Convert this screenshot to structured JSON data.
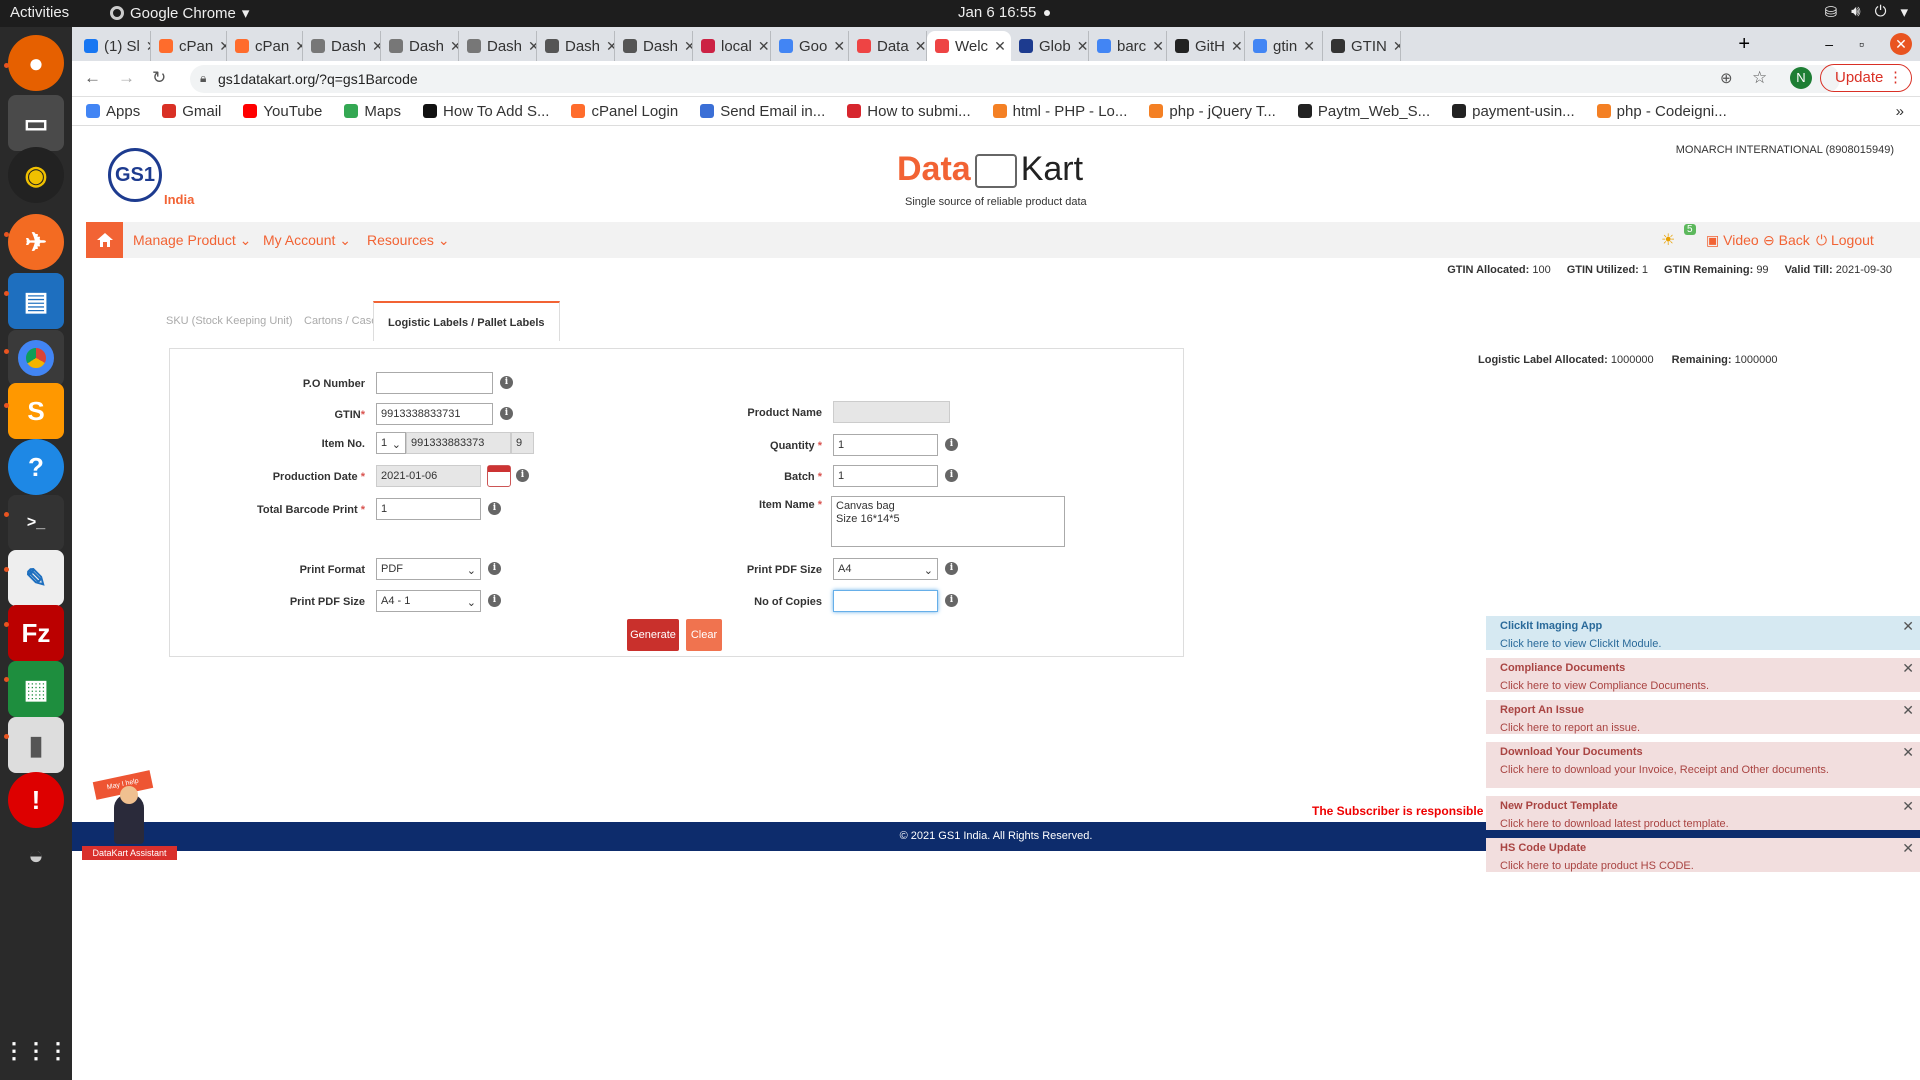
{
  "os": {
    "activities": "Activities",
    "app_menu": "Google Chrome",
    "clock": "Jan 6  16:55"
  },
  "tabs": [
    {
      "label": "(1) Sl",
      "color": "#1877f2"
    },
    {
      "label": "cPan",
      "color": "#ff6c2c"
    },
    {
      "label": "cPan",
      "color": "#ff6c2c"
    },
    {
      "label": "Dash",
      "color": "#777"
    },
    {
      "label": "Dash",
      "color": "#777"
    },
    {
      "label": "Dash",
      "color": "#777"
    },
    {
      "label": "Dash",
      "color": "#555"
    },
    {
      "label": "Dash",
      "color": "#555"
    },
    {
      "label": "local",
      "color": "#c24"
    },
    {
      "label": "Goo",
      "color": "#4285f4"
    },
    {
      "label": "Data",
      "color": "#e44"
    },
    {
      "label": "Welc",
      "color": "#e44",
      "active": true
    },
    {
      "label": "Glob",
      "color": "#1d3b8f"
    },
    {
      "label": "barc",
      "color": "#4285f4"
    },
    {
      "label": "GitH",
      "color": "#222"
    },
    {
      "label": "gtin",
      "color": "#4285f4"
    },
    {
      "label": "GTIN",
      "color": "#333"
    }
  ],
  "omnibar": {
    "url": "gs1datakart.org/?q=gs1Barcode",
    "profile": "N",
    "update": "Update"
  },
  "bookmarks": [
    {
      "label": "Apps",
      "color": "#4285f4"
    },
    {
      "label": "Gmail",
      "color": "#d93025"
    },
    {
      "label": "YouTube",
      "color": "#ff0000"
    },
    {
      "label": "Maps",
      "color": "#34a853"
    },
    {
      "label": "How To Add S...",
      "color": "#111"
    },
    {
      "label": "cPanel Login",
      "color": "#ff6c2c"
    },
    {
      "label": "Send Email in...",
      "color": "#3b6fd6"
    },
    {
      "label": "How to submi...",
      "color": "#d7262e"
    },
    {
      "label": "html - PHP - Lo...",
      "color": "#f48024"
    },
    {
      "label": "php - jQuery T...",
      "color": "#f48024"
    },
    {
      "label": "Paytm_Web_S...",
      "color": "#222"
    },
    {
      "label": "payment-usin...",
      "color": "#222"
    },
    {
      "label": "php - Codeigni...",
      "color": "#f48024"
    }
  ],
  "header": {
    "logo": "GS1",
    "logo_sub": "India",
    "brand_data": "Data",
    "brand_kart": "Kart",
    "tagline": "Single source of reliable product data",
    "company": "MONARCH INTERNATIONAL (8908015949)"
  },
  "nav": {
    "manage": "Manage Product",
    "account": "My Account",
    "resources": "Resources",
    "badge": "5",
    "video": "Video",
    "back": "Back",
    "logout": "Logout"
  },
  "stats": {
    "allocated_label": "GTIN Allocated:",
    "allocated": "100",
    "utilized_label": "GTIN Utilized:",
    "utilized": "1",
    "remaining_label": "GTIN Remaining:",
    "remaining": "99",
    "valid_label": "Valid Till:",
    "valid": "2021-09-30"
  },
  "page_tabs": {
    "sku": "SKU (Stock Keeping Unit)",
    "cartons": "Cartons / Cases",
    "logistic": "Logistic Labels / Pallet Labels"
  },
  "alloc": {
    "allocated_label": "Logistic Label Allocated:",
    "allocated": "1000000",
    "remaining_label": "Remaining:",
    "remaining": "1000000"
  },
  "form": {
    "po_label": "P.O Number",
    "po_value": "",
    "gtin_label": "GTIN",
    "gtin_value": "9913338833731",
    "item_no_label": "Item No.",
    "item_no_select": "1",
    "item_no_code": "991333883373",
    "item_no_check": "9",
    "prod_date_label": "Production Date",
    "prod_date_value": "2021-01-06",
    "total_print_label": "Total Barcode Print",
    "total_print_value": "1",
    "print_format_label": "Print Format",
    "print_format_value": "PDF",
    "print_pdf_size_label": "Print PDF Size",
    "print_pdf_size_value": "A4 - 1",
    "product_name_label": "Product Name",
    "product_name_value": "",
    "quantity_label": "Quantity",
    "quantity_value": "1",
    "batch_label": "Batch",
    "batch_value": "1",
    "item_name_label": "Item Name",
    "item_name_value": "Canvas bag\nSize 16*14*5",
    "right_pdf_size_label": "Print PDF Size",
    "right_pdf_size_value": "A4",
    "copies_label": "No of Copies",
    "copies_value": "",
    "required_mark": "*",
    "info": "i",
    "generate": "Generate",
    "clear": "Clear"
  },
  "warning": "The Subscriber is responsible for completeness and accur",
  "footer": "© 2021 GS1 India. All Rights Reserved.",
  "notices": [
    {
      "title": "ClickIt Imaging App",
      "text": "Click here to view ClickIt Module.",
      "color": "#2a6a9a",
      "bg": "#d6e9f2"
    },
    {
      "title": "Compliance Documents",
      "text": "Click here to view Compliance Documents.",
      "color": "#a94442",
      "bg": "#f2dede"
    },
    {
      "title": "Report An Issue",
      "text": "Click here to report an issue.",
      "color": "#a94442",
      "bg": "#f2dede"
    },
    {
      "title": "Download Your Documents",
      "text": "Click here to download your Invoice, Receipt and Other documents.",
      "color": "#a94442",
      "bg": "#f2dede"
    },
    {
      "title": "New Product Template",
      "text": "Click here to download latest product template.",
      "color": "#a94442",
      "bg": "#f2dede"
    },
    {
      "title": "HS Code Update",
      "text": "Click here to update product HS CODE.",
      "color": "#a94442",
      "bg": "#f2dede"
    }
  ],
  "assistant": {
    "label": "DataKart Assistant",
    "sign": "May I help"
  },
  "colors": {
    "accent": "#f26334",
    "navy": "#0d2c6c",
    "gs1_blue": "#1d3b8f"
  }
}
